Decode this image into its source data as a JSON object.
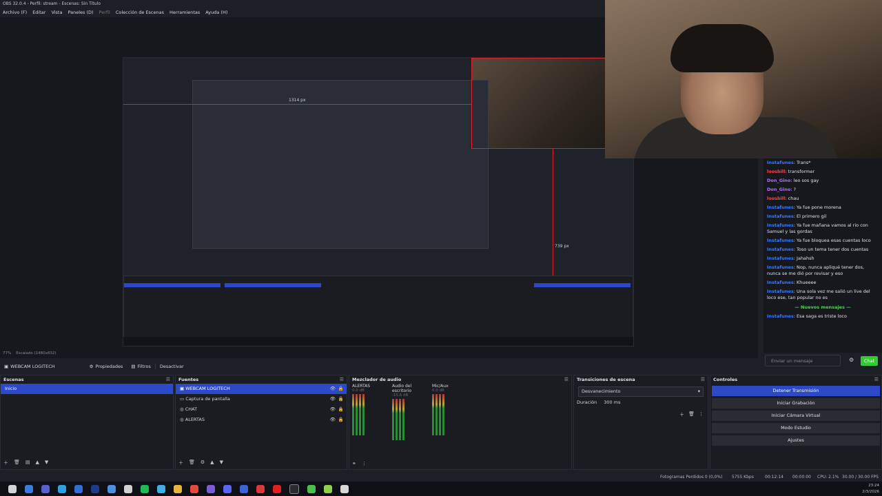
{
  "window": {
    "title": "OBS 32.0.4 - Perfil: stream - Escenas: Sin Título"
  },
  "menu": [
    {
      "label": "Archivo (F)"
    },
    {
      "label": "Editar"
    },
    {
      "label": "Vista"
    },
    {
      "label": "Paneles (D)"
    },
    {
      "label": "Perfil",
      "dim": true
    },
    {
      "label": "Colección de Escenas"
    },
    {
      "label": "Herramientas"
    },
    {
      "label": "Ayuda (H)"
    }
  ],
  "preview": {
    "nested_width_label": "1314 px",
    "nested_height_label": "739 px",
    "zoom_label": "77%",
    "scale_label": "Escalado (1480x832)"
  },
  "chat": {
    "messages": [
      {
        "user": "Instafunes",
        "text": "Trans*",
        "color": "blue"
      },
      {
        "user": "loosbill",
        "text": "transformer",
        "color": "red"
      },
      {
        "user": "Don_Gino",
        "text": "leo sos gay",
        "color": "violet"
      },
      {
        "user": "Don_Gino",
        "text": "?",
        "color": "violet"
      },
      {
        "user": "loosbill",
        "text": "chau",
        "color": "red"
      },
      {
        "user": "Instafunes",
        "text": "Ya fue pone morena",
        "color": "blue"
      },
      {
        "user": "Instafunes",
        "text": "El primero gil",
        "color": "blue"
      },
      {
        "user": "Instafunes",
        "text": "Ya fue mañana vamos al rio con Samuel y las gordas",
        "color": "blue"
      },
      {
        "user": "Instafunes",
        "text": "Ya fue bloquea esas cuentas loco",
        "color": "blue"
      },
      {
        "user": "Instafunes",
        "text": "Toso un tema tener dos cuentas",
        "color": "blue"
      },
      {
        "user": "Instafunes",
        "text": "Jahahsh",
        "color": "blue"
      },
      {
        "user": "Instafunes",
        "text": "Nop, nunca apliqué tener dos, nunca se me dió por revisar y eso",
        "color": "blue"
      },
      {
        "user": "Instafunes",
        "text": "Khueeee",
        "color": "blue"
      },
      {
        "user": "Instafunes",
        "text": "Una sola vez me salió un live del loco ese, tan popular no es",
        "color": "blue"
      }
    ],
    "new_messages_label": "Nuevos mensajes",
    "last_message": {
      "user": "Instafunes",
      "text": "Esa saga es triste loco",
      "color": "blue"
    },
    "input_placeholder": "Enviar un mensaje",
    "send_label": "Chat"
  },
  "source_toolbar": {
    "selected_source": "WEBCAM LOGITECH",
    "properties_label": "Propiedades",
    "filters_label": "Filtros",
    "deactivate_label": "Desactivar"
  },
  "scenes": {
    "header": "Escenas",
    "items": [
      {
        "name": "Inicio",
        "selected": true
      }
    ]
  },
  "sources": {
    "header": "Fuentes",
    "items": [
      {
        "name": "WEBCAM LOGITECH",
        "selected": true,
        "icon": "camera-icon"
      },
      {
        "name": "Captura de pantalla",
        "selected": false,
        "icon": "monitor-icon"
      },
      {
        "name": "CHAT",
        "selected": false,
        "icon": "globe-icon"
      },
      {
        "name": "ALERTAS",
        "selected": false,
        "icon": "globe-icon"
      }
    ]
  },
  "mixer": {
    "header": "Mezclador de audio",
    "channels": [
      {
        "name": "ALERTAS",
        "db": "0.0 dB"
      },
      {
        "name": "Audio del escritorio",
        "db": "-15.6 dB"
      },
      {
        "name": "Mic/Aux",
        "db": "0.0 dB"
      }
    ]
  },
  "transitions": {
    "header": "Transiciones de escena",
    "selected": "Desvanecimiento",
    "duration_label": "Duración",
    "duration_value": "300 ms"
  },
  "controls": {
    "header": "Controles",
    "buttons": [
      {
        "label": "Detener Transmisión",
        "active": true
      },
      {
        "label": "Iniciar Grabación",
        "active": false
      },
      {
        "label": "Iniciar Cámara Virtual",
        "active": false
      },
      {
        "label": "Modo Estudio",
        "active": false
      },
      {
        "label": "Ajustes",
        "active": false
      }
    ]
  },
  "status": {
    "dropped_frames": "Fotogramas Perdidos 0 (0,0%)",
    "bitrate": "5755 Kbps",
    "stream_time": "00:12:14",
    "rec_time": "00:00:00",
    "cpu": "CPU: 2.1%",
    "fps": "30.00 / 30.00 FPS"
  },
  "clock": {
    "time": "23:24",
    "date": "2/3/2026"
  },
  "colors": {
    "accent": "#2c49c7",
    "chat_send": "#37c837",
    "guide_red": "#e0202a"
  }
}
